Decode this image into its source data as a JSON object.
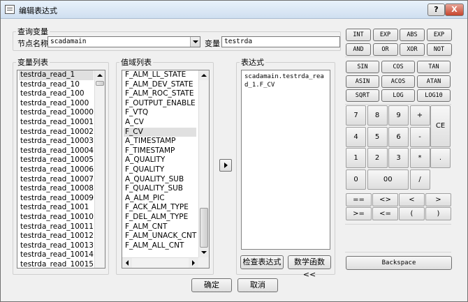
{
  "window": {
    "title": "编辑表达式",
    "help_label": "?",
    "close_label": "X"
  },
  "query": {
    "group_label": "查询变量",
    "node_label": "节点名称",
    "node_value": "scadamain",
    "var_label": "变量",
    "var_value": "testrda"
  },
  "variables": {
    "label": "变量列表",
    "items": [
      "testrda_read_1",
      "testrda_read_10",
      "testrda_read_100",
      "testrda_read_1000",
      "testrda_read_10000",
      "testrda_read_10001",
      "testrda_read_10002",
      "testrda_read_10003",
      "testrda_read_10004",
      "testrda_read_10005",
      "testrda_read_10006",
      "testrda_read_10007",
      "testrda_read_10008",
      "testrda_read_10009",
      "testrda_read_1001",
      "testrda_read_10010",
      "testrda_read_10011",
      "testrda_read_10012",
      "testrda_read_10013",
      "testrda_read_10014",
      "testrda_read_10015"
    ],
    "selected_index": 0
  },
  "fields": {
    "label": "值域列表",
    "items": [
      "F_ALM_LL_STATE",
      "F_ALM_DEV_STATE",
      "F_ALM_ROC_STATE",
      "F_OUTPUT_ENABLE",
      "F_VTQ",
      "A_CV",
      "F_CV",
      "A_TIMESTAMP",
      "F_TIMESTAMP",
      "A_QUALITY",
      "F_QUALITY",
      "A_QUALITY_SUB",
      "F_QUALITY_SUB",
      "A_ALM_PIC",
      "F_ACK_ALM_TYPE",
      "F_DEL_ALM_TYPE",
      "F_ALM_CNT",
      "F_ALM_UNACK_CNT",
      "F_ALM_ALL_CNT"
    ],
    "selected_index": 6
  },
  "expression": {
    "label": "表达式",
    "text": "scadamain.testrda_read_1.F_CV",
    "check_label": "检查表达式",
    "math_label": "数学函数<<"
  },
  "functions": {
    "row1": [
      "INT",
      "EXP",
      "ABS",
      "EXP"
    ],
    "row2": [
      "AND",
      "OR",
      "XOR",
      "NOT"
    ],
    "trig1": [
      "SIN",
      "COS",
      "TAN"
    ],
    "trig2": [
      "ASIN",
      "ACOS",
      "ATAN"
    ],
    "trig3": [
      "SQRT",
      "LOG",
      "LOG10"
    ]
  },
  "keypad": {
    "row1": [
      "7",
      "8",
      "9",
      "+"
    ],
    "row2": [
      "4",
      "5",
      "6",
      "-"
    ],
    "row3": [
      "1",
      "2",
      "3",
      "*",
      "."
    ],
    "row4": [
      "0",
      "00",
      "/"
    ],
    "clear": "CE"
  },
  "operators": {
    "row1": [
      "==",
      "<>",
      "<",
      ">"
    ],
    "row2": [
      ">=",
      "<=",
      "(",
      ")"
    ]
  },
  "backspace_label": "Backspace",
  "ok_label": "确定",
  "cancel_label": "取消"
}
